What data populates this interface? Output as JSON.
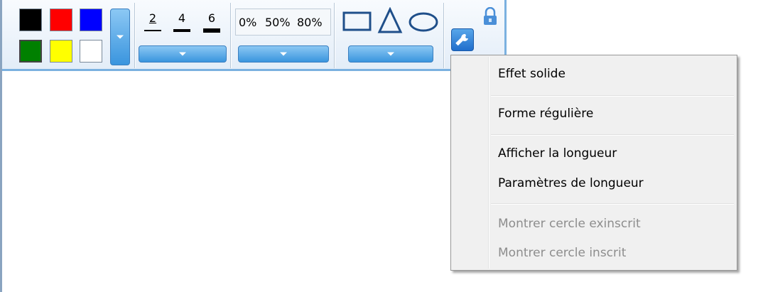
{
  "palette": {
    "colors": [
      "#000000",
      "#ff0000",
      "#0000ff",
      "#008000",
      "#ffff00",
      "#ffffff"
    ]
  },
  "stroke_widths": [
    {
      "label": "2"
    },
    {
      "label": "4"
    },
    {
      "label": "6"
    }
  ],
  "opacity": [
    "0%",
    "50%",
    "80%"
  ],
  "shapes": [
    "rectangle-icon",
    "triangle-icon",
    "ellipse-icon"
  ],
  "tools": {
    "settings": "wrench-icon",
    "lock": "lock-icon"
  },
  "context_menu": {
    "items": [
      {
        "label": "Effet solide",
        "enabled": true
      },
      {
        "label": "Forme régulière",
        "enabled": true
      },
      {
        "label": "Afficher la longueur",
        "enabled": true
      },
      {
        "label": "Paramètres de longueur",
        "enabled": true
      },
      {
        "label": "Montrer cercle exinscrit",
        "enabled": false
      },
      {
        "label": "Montrer cercle inscrit",
        "enabled": false
      }
    ]
  },
  "colors": {
    "accent": "#3a95de",
    "toolbar_border": "#7bb1e0",
    "disabled_text": "#8d8d8d"
  }
}
